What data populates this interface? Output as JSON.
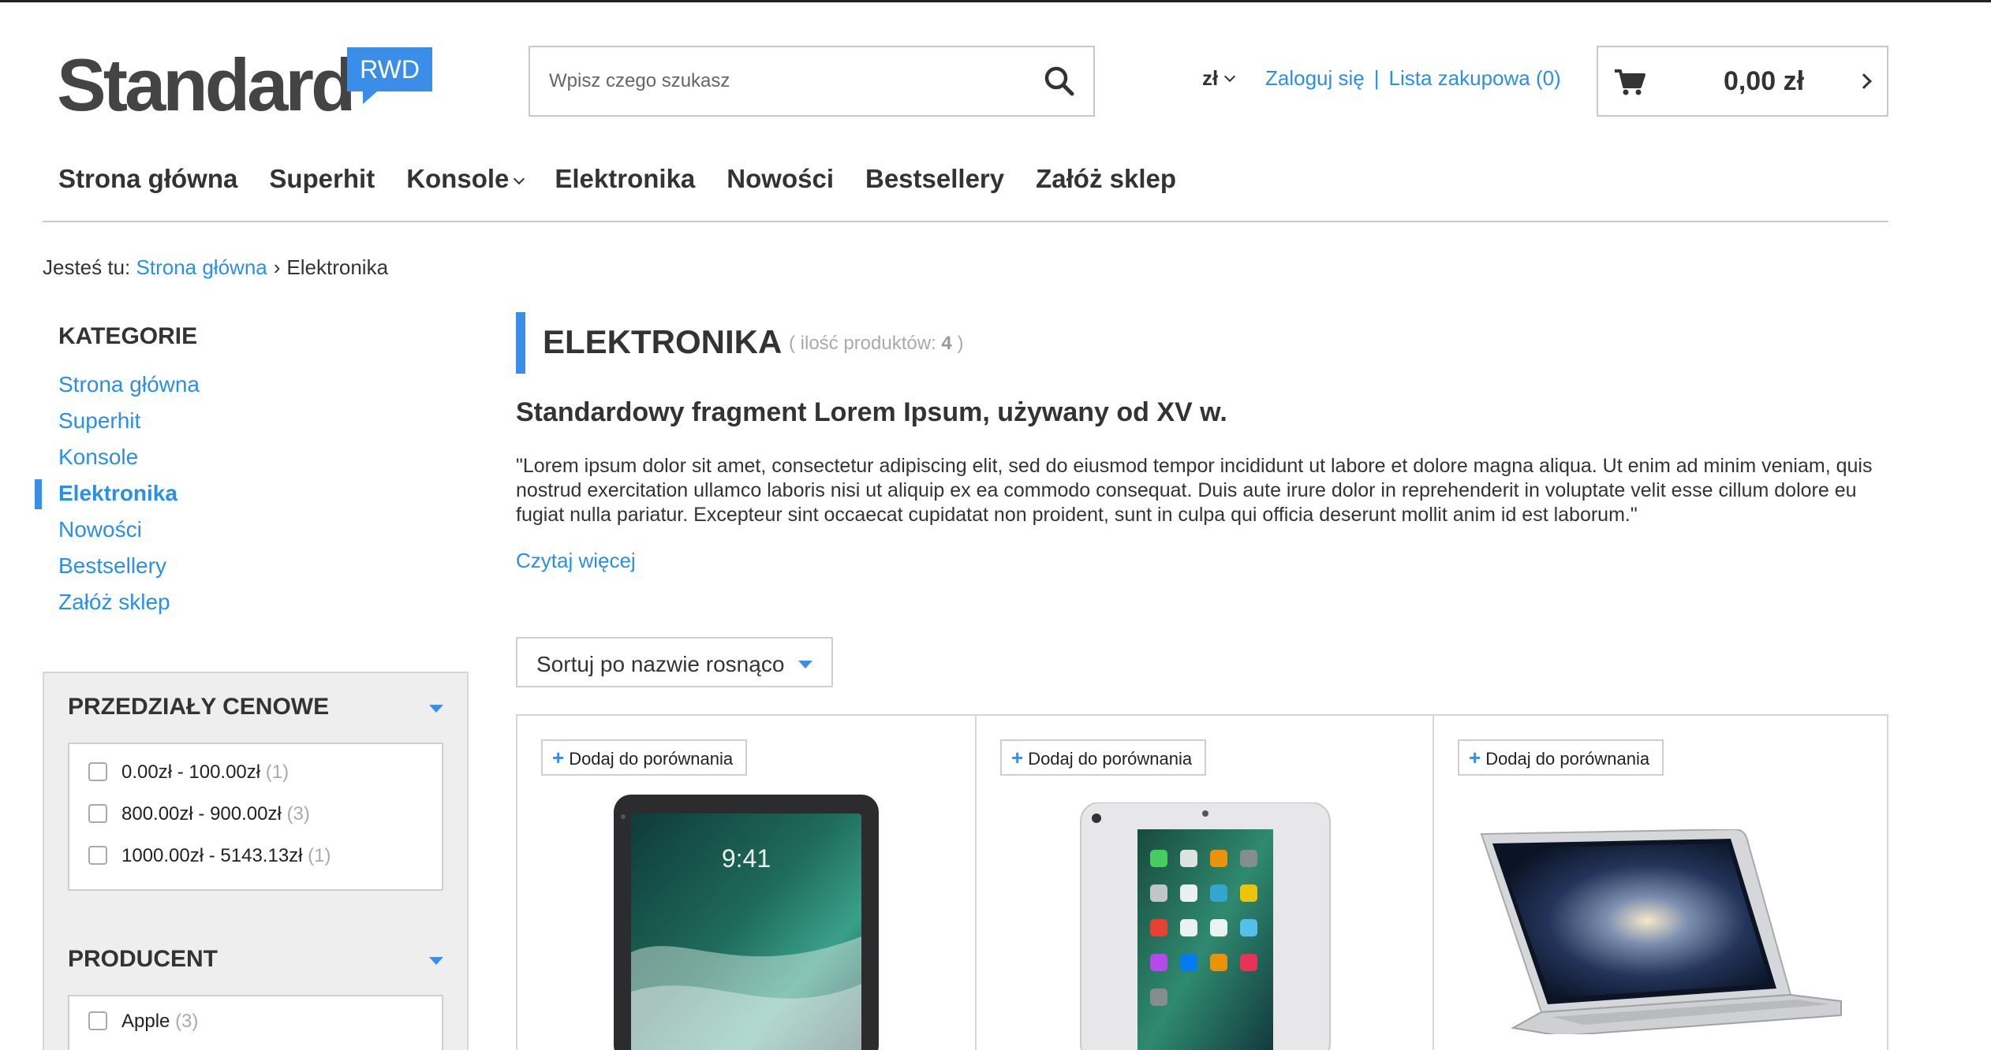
{
  "header": {
    "logo_text": "Standard",
    "logo_badge": "RWD",
    "search_placeholder": "Wpisz czego szukasz",
    "currency": "zł",
    "login": "Zaloguj się",
    "separator": "|",
    "shopping_list": "Lista zakupowa (0)",
    "cart_total": "0,00 zł"
  },
  "nav": {
    "items": [
      "Strona główna",
      "Superhit",
      "Konsole",
      "Elektronika",
      "Nowości",
      "Bestsellery",
      "Załóż sklep"
    ]
  },
  "breadcrumb": {
    "prefix": "Jesteś tu:",
    "home": "Strona główna",
    "arrow": "›",
    "current": "Elektronika"
  },
  "sidebar": {
    "categories_title": "KATEGORIE",
    "categories": [
      "Strona główna",
      "Superhit",
      "Konsole",
      "Elektronika",
      "Nowości",
      "Bestsellery",
      "Załóż sklep"
    ],
    "active_category": "Elektronika",
    "price_title": "PRZEDZIAŁY CENOWE",
    "price_ranges": [
      {
        "label": "0.00zł - 100.00zł",
        "count": "(1)"
      },
      {
        "label": "800.00zł - 900.00zł",
        "count": "(3)"
      },
      {
        "label": "1000.00zł - 5143.13zł",
        "count": "(1)"
      }
    ],
    "producer_title": "PRODUCENT",
    "producers": [
      {
        "label": "Apple",
        "count": "(3)"
      }
    ]
  },
  "main": {
    "title": "ELEKTRONIKA",
    "count_prefix": "( ilość produktów:",
    "count_value": "4",
    "count_suffix": ")",
    "subtitle": "Standardowy fragment Lorem Ipsum, używany od XV w.",
    "description": "\"Lorem ipsum dolor sit amet, consectetur adipiscing elit, sed do eiusmod tempor incididunt ut labore et dolore magna aliqua. Ut enim ad minim veniam, quis nostrud exercitation ullamco laboris nisi ut aliquip ex ea commodo consequat. Duis aute irure dolor in reprehenderit in voluptate velit esse cillum dolore eu fugiat nulla pariatur. Excepteur sint occaecat cupidatat non proident, sunt in culpa qui officia deserunt mollit anim id est laborum.\"",
    "read_more": "Czytaj więcej",
    "sort_label": "Sortuj po nazwie rosnąco",
    "compare_label": "Dodaj do porównania",
    "product_thumbs": [
      "ipad-pro-space-gray",
      "ipad-silver",
      "macbook-air"
    ],
    "ipad_time": "9:41"
  },
  "colors": {
    "accent": "#3b8ee8",
    "link": "#2a8fe8",
    "text": "#333333",
    "muted": "#aaaaaa",
    "border": "#c8c8c8"
  }
}
